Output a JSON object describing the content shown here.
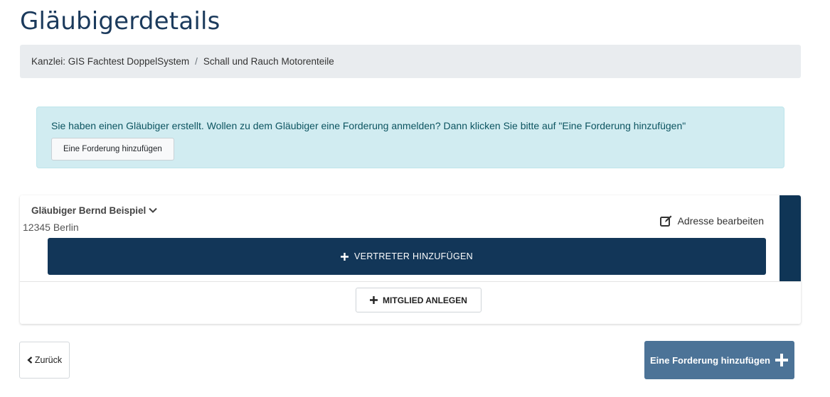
{
  "page": {
    "title": "Gläubigerdetails"
  },
  "breadcrumb": {
    "items": [
      "Kanzlei: GIS Fachtest DoppelSystem",
      "Schall und Rauch Motorenteile"
    ],
    "separator": "/"
  },
  "alert": {
    "message": "Sie haben einen Gläubiger erstellt. Wollen zu dem Gläubiger eine Forderung anmelden? Dann klicken Sie bitte auf \"Eine Forderung hinzufügen\"",
    "button_label": "Eine Forderung hinzufügen"
  },
  "creditor": {
    "name": "Gläubiger Bernd Beispiel",
    "city": "12345 Berlin",
    "edit_label": "Adresse bearbeiten",
    "add_representative_label": "VERTRETER HINZUFÜGEN",
    "add_member_label": "MITGLIED ANLEGEN",
    "icons": [
      "chevron-down-icon",
      "edit-icon",
      "plus-icon"
    ]
  },
  "footer": {
    "back_label": "Zurück",
    "add_claim_label": "Eine Forderung hinzufügen"
  },
  "colors": {
    "title": "#1b3a5c",
    "primary_dark": "#123658",
    "side_bar": "#0f3556",
    "alert_bg": "#d1ecf1",
    "alert_text": "#0c5460",
    "add_claim_bg": "#4c7397",
    "breadcrumb_bg": "#e9ecef"
  }
}
